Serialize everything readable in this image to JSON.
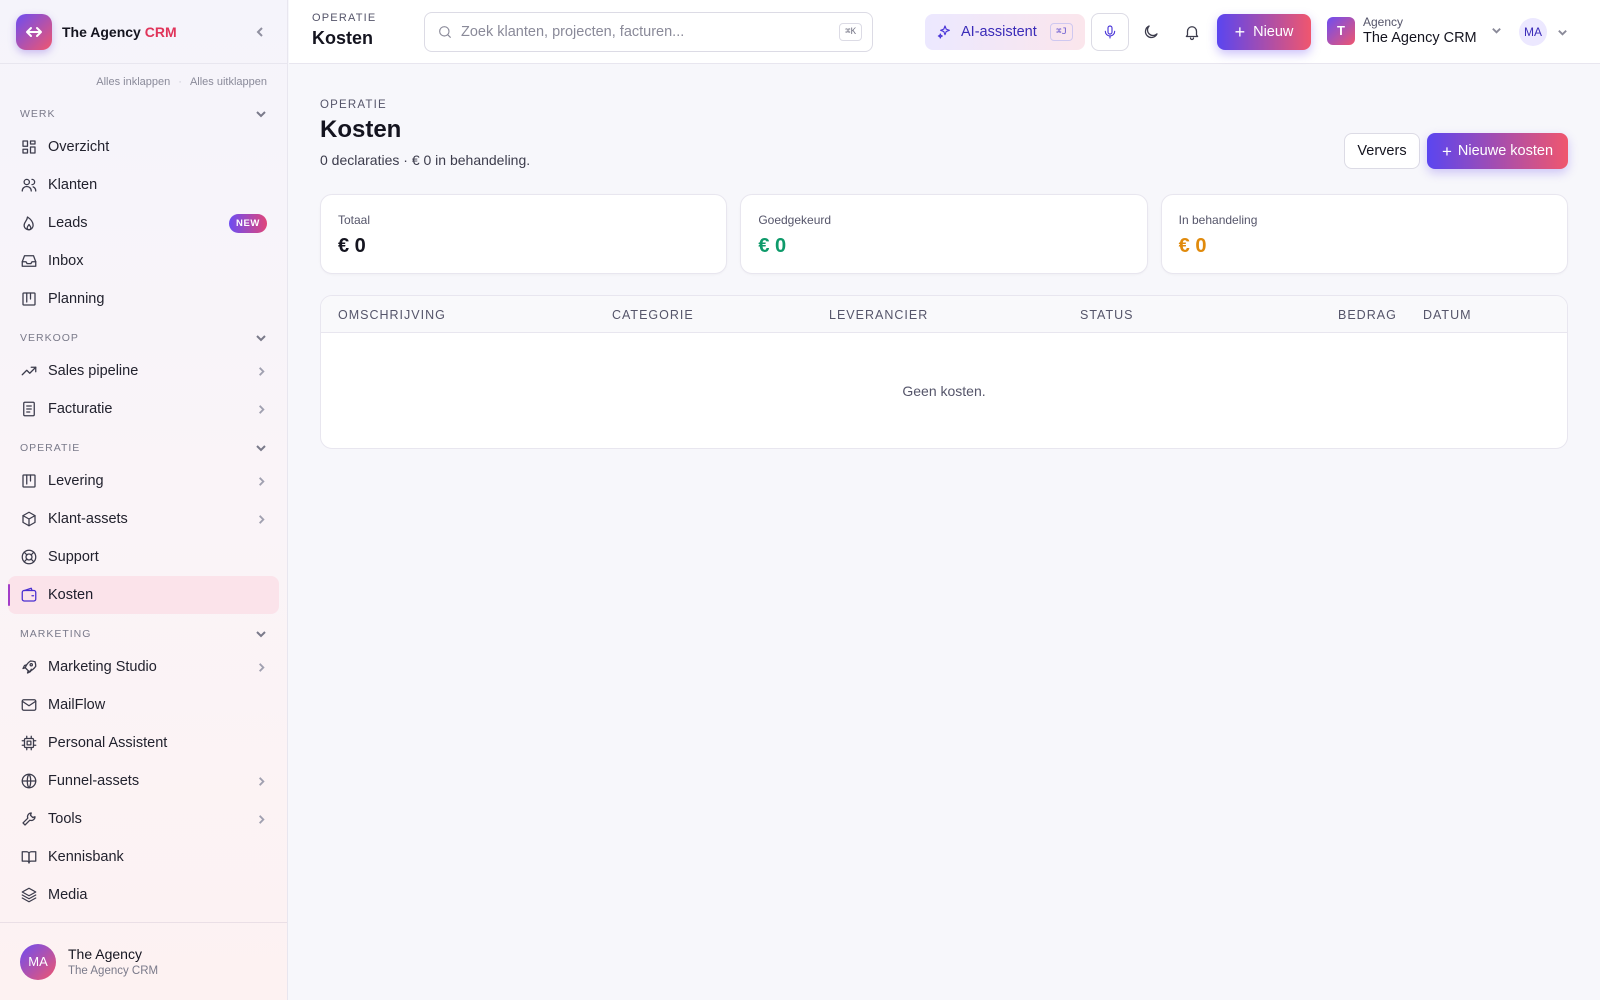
{
  "app": {
    "name": "The Agency",
    "name_accent": "CRM"
  },
  "sidebar": {
    "collapse_all": "Alles inklappen",
    "expand_all": "Alles uitklappen",
    "sections": [
      {
        "label": "WERK",
        "items": [
          {
            "label": "Overzicht",
            "icon": "dashboard-icon"
          },
          {
            "label": "Klanten",
            "icon": "users-icon"
          },
          {
            "label": "Leads",
            "icon": "flame-icon",
            "badge": "NEW"
          },
          {
            "label": "Inbox",
            "icon": "inbox-icon"
          },
          {
            "label": "Planning",
            "icon": "kanban-icon"
          }
        ]
      },
      {
        "label": "VERKOOP",
        "items": [
          {
            "label": "Sales pipeline",
            "icon": "trending-up-icon",
            "submenu": true
          },
          {
            "label": "Facturatie",
            "icon": "invoice-icon",
            "submenu": true
          }
        ]
      },
      {
        "label": "OPERATIE",
        "items": [
          {
            "label": "Levering",
            "icon": "kanban-icon",
            "submenu": true
          },
          {
            "label": "Klant-assets",
            "icon": "box-icon",
            "submenu": true
          },
          {
            "label": "Support",
            "icon": "lifebuoy-icon"
          },
          {
            "label": "Kosten",
            "icon": "wallet-icon",
            "active": true
          }
        ]
      },
      {
        "label": "MARKETING",
        "items": [
          {
            "label": "Marketing Studio",
            "icon": "rocket-icon",
            "submenu": true
          },
          {
            "label": "MailFlow",
            "icon": "mail-icon"
          },
          {
            "label": "Personal Assistent",
            "icon": "cpu-icon"
          },
          {
            "label": "Funnel-assets",
            "icon": "globe-icon",
            "submenu": true
          },
          {
            "label": "Tools",
            "icon": "wrench-icon",
            "submenu": true
          },
          {
            "label": "Kennisbank",
            "icon": "book-icon"
          },
          {
            "label": "Media",
            "icon": "layers-icon"
          }
        ]
      }
    ],
    "footer": {
      "initials": "MA",
      "name": "The Agency",
      "sub": "The Agency CRM"
    }
  },
  "topbar": {
    "section": "OPERATIE",
    "title": "Kosten",
    "search_placeholder": "Zoek klanten, projecten, facturen...",
    "search_value": "",
    "search_shortcut": "⌘K",
    "ai_label": "AI-assistent",
    "ai_shortcut": "⌘J",
    "new_label": "Nieuw",
    "workspace": {
      "logo": "T",
      "sub": "Agency",
      "name": "The Agency CRM"
    },
    "user_initials": "MA"
  },
  "page": {
    "section": "OPERATIE",
    "title": "Kosten",
    "subtitle": "0 declaraties · € 0 in behandeling.",
    "refresh_label": "Ververs",
    "add_label": "Nieuwe kosten",
    "stats": [
      {
        "label": "Totaal",
        "value": "€ 0",
        "color": "#14141f"
      },
      {
        "label": "Goedgekeurd",
        "value": "€ 0",
        "color": "#0e9a6a"
      },
      {
        "label": "In behandeling",
        "value": "€ 0",
        "color": "#e08a0c"
      }
    ],
    "table": {
      "columns": [
        "OMSCHRIJVING",
        "CATEGORIE",
        "LEVERANCIER",
        "STATUS",
        "BEDRAG",
        "DATUM"
      ],
      "empty": "Geen kosten."
    }
  },
  "colors": {
    "accent": "#5a45f0",
    "accent_end": "#f0566e",
    "active_bg": "#fbe3ea"
  }
}
